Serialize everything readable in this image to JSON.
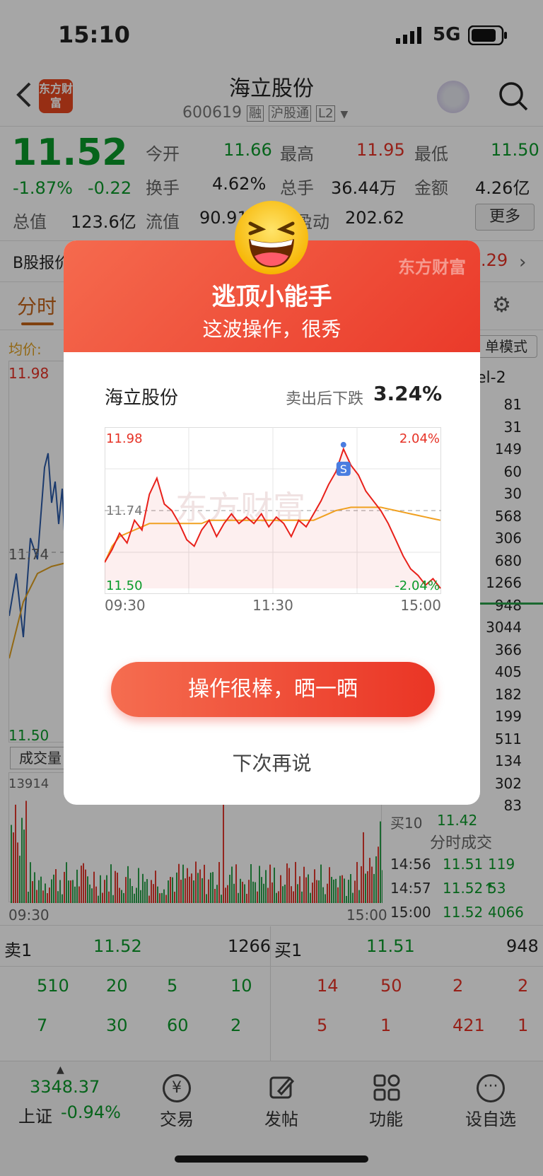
{
  "status_bar": {
    "time": "15:10",
    "network": "5G"
  },
  "header": {
    "logo_text": "东方财富",
    "stock_name": "海立股份",
    "stock_code": "600619",
    "tags": [
      "融",
      "沪股通",
      "L2"
    ]
  },
  "quote": {
    "price": "11.52",
    "change_pct": "-1.87%",
    "change_amt": "-0.22",
    "total_value_label": "总值",
    "total_value": "123.6亿",
    "fields": [
      {
        "label": "今开",
        "value": "11.66"
      },
      {
        "label": "最高",
        "value": "11.95"
      },
      {
        "label": "最低",
        "value": "11.50"
      },
      {
        "label": "换手",
        "value": "4.62%"
      },
      {
        "label": "总手",
        "value": "36.44万"
      },
      {
        "label": "金额",
        "value": "4.26亿"
      },
      {
        "label": "流值",
        "value": "90.91"
      },
      {
        "label": "盈动",
        "value": "202.62"
      }
    ],
    "more_label": "更多"
  },
  "b_share": {
    "label": "B股报价",
    "value": ".29"
  },
  "chart_tabs": {
    "active": "分时",
    "mode_label": "单模式",
    "level": "el-2"
  },
  "avg_label": "均价:",
  "left_chart": {
    "high": "11.98",
    "mid": "11.74",
    "low": "11.50",
    "volume_label": "成交量",
    "volume_max": "13914",
    "time_start": "09:30",
    "time_end": "15:00"
  },
  "order_book_right": {
    "values": [
      "81",
      "31",
      "149",
      "60",
      "30",
      "568",
      "306",
      "680",
      "1266",
      "948",
      "3044",
      "366",
      "405",
      "182",
      "199",
      "511",
      "134",
      "302",
      "83"
    ],
    "buy10_label": "买10",
    "buy10_price": "11.42",
    "buy10_vol": "83"
  },
  "tick_trades": {
    "title": "分时成交",
    "rows": [
      {
        "time": "14:56",
        "price": "11.51",
        "vol": "119"
      },
      {
        "time": "14:57",
        "price": "11.52↑",
        "vol": "53"
      },
      {
        "time": "15:00",
        "price": "11.52",
        "vol": "4066"
      }
    ]
  },
  "level1": {
    "sell_label": "卖1",
    "sell_price": "11.52",
    "sell_vol": "1266",
    "buy_label": "买1",
    "buy_price": "11.51",
    "buy_vol": "948",
    "sell_queue": [
      [
        "510",
        "20",
        "5",
        "10"
      ],
      [
        "7",
        "30",
        "60",
        "2"
      ]
    ],
    "buy_queue": [
      [
        "14",
        "50",
        "2",
        "2"
      ],
      [
        "5",
        "1",
        "421",
        "1"
      ]
    ]
  },
  "tabbar": {
    "index_value": "3348.37",
    "index_name": "上证",
    "index_change": "-0.94%",
    "items": [
      {
        "label": "交易",
        "icon": "yuan-cycle-icon"
      },
      {
        "label": "发帖",
        "icon": "edit-icon"
      },
      {
        "label": "功能",
        "icon": "grid-icon"
      },
      {
        "label": "设自选",
        "icon": "more-dots-icon"
      }
    ]
  },
  "modal": {
    "brand": "东方财富",
    "title": "逃顶小能手",
    "subtitle": "这波操作，很秀",
    "stock_name": "海立股份",
    "drop_label": "卖出后下跌",
    "drop_value": "3.24%",
    "chart_watermark": "东方财富",
    "sell_marker": "S",
    "share_button": "操作很棒，晒一晒",
    "later_button": "下次再说"
  },
  "chart_data": {
    "type": "line",
    "title": "",
    "xlabel": "",
    "ylabel": "",
    "x_ticks": [
      "09:30",
      "11:30",
      "15:00"
    ],
    "ylim": [
      11.5,
      11.98
    ],
    "y_left_labels": [
      "11.98",
      "11.74",
      "11.50"
    ],
    "y_right_labels": [
      "2.04%",
      "-2.04%"
    ],
    "reference": 11.74,
    "grid": true,
    "series": [
      {
        "color": "#e8201a",
        "values": [
          11.58,
          11.62,
          11.67,
          11.64,
          11.71,
          11.68,
          11.79,
          11.84,
          11.76,
          11.74,
          11.7,
          11.65,
          11.63,
          11.68,
          11.71,
          11.66,
          11.7,
          11.73,
          11.7,
          11.72,
          11.7,
          11.73,
          11.69,
          11.72,
          11.7,
          11.66,
          11.71,
          11.69,
          11.73,
          11.77,
          11.82,
          11.86,
          11.93,
          11.88,
          11.85,
          11.8,
          11.77,
          11.74,
          11.7,
          11.65,
          11.6,
          11.56,
          11.54,
          11.51,
          11.53,
          11.5
        ]
      },
      {
        "color": "#f0a020",
        "values": [
          11.58,
          11.63,
          11.66,
          11.67,
          11.68,
          11.69,
          11.7,
          11.7,
          11.7,
          11.7,
          11.7,
          11.7,
          11.7,
          11.7,
          11.71,
          11.71,
          11.71,
          11.71,
          11.71,
          11.71,
          11.71,
          11.71,
          11.71,
          11.71,
          11.71,
          11.71,
          11.71,
          11.71,
          11.71,
          11.72,
          11.73,
          11.74,
          11.745,
          11.75,
          11.75,
          11.75,
          11.75,
          11.75,
          11.745,
          11.74,
          11.735,
          11.73,
          11.725,
          11.72,
          11.715,
          11.71
        ]
      }
    ]
  }
}
